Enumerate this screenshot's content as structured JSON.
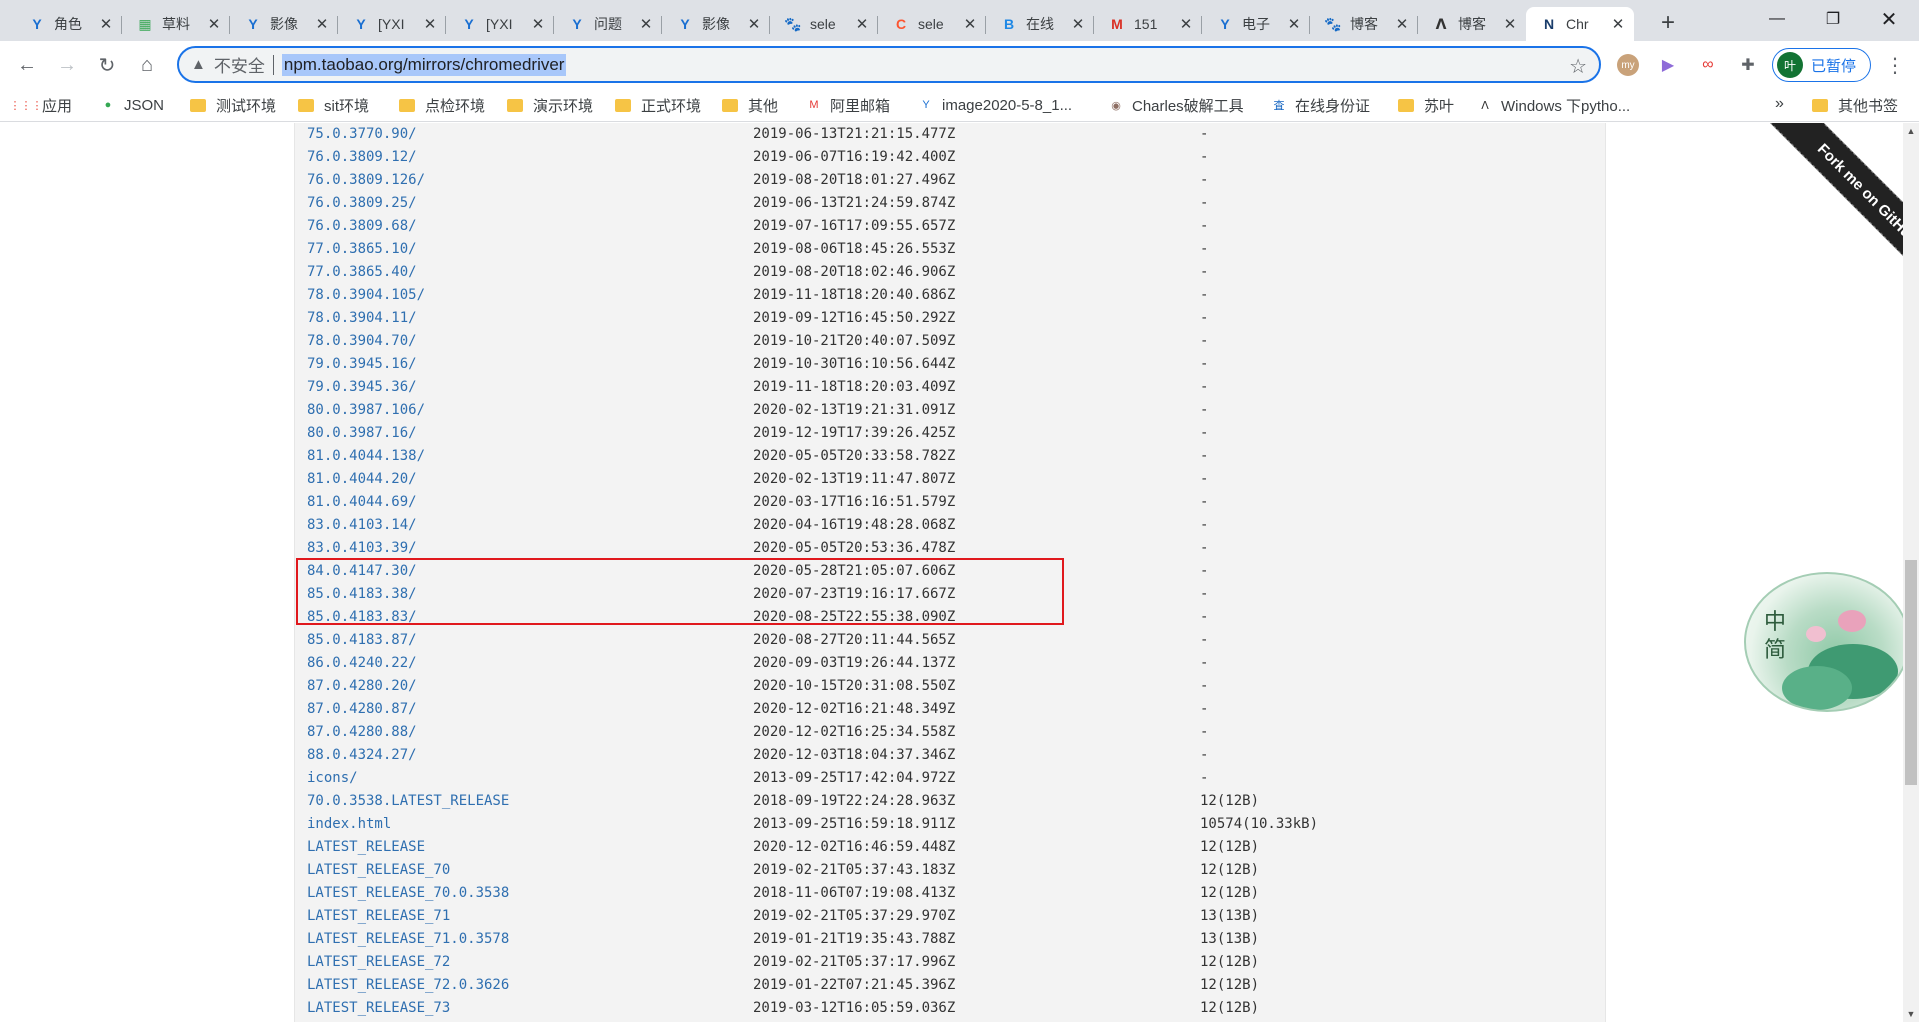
{
  "tabs": [
    {
      "title": "角色",
      "icon": "Y",
      "icon_name": "yonyou-icon",
      "color": "#1a6fd1"
    },
    {
      "title": "草料",
      "icon": "▦",
      "icon_name": "qr-grid-icon",
      "color": "#3aa757"
    },
    {
      "title": "影像",
      "icon": "Y",
      "icon_name": "yonyou-icon",
      "color": "#1a6fd1"
    },
    {
      "title": "[YXI",
      "icon": "Y",
      "icon_name": "yonyou-icon",
      "color": "#1a6fd1"
    },
    {
      "title": "[YXI",
      "icon": "Y",
      "icon_name": "yonyou-icon",
      "color": "#1a6fd1"
    },
    {
      "title": "问题",
      "icon": "Y",
      "icon_name": "yonyou-icon",
      "color": "#1a6fd1"
    },
    {
      "title": "影像",
      "icon": "Y",
      "icon_name": "yonyou-icon",
      "color": "#1a6fd1"
    },
    {
      "title": "sele",
      "icon": "🐾",
      "icon_name": "baidu-paw-icon",
      "color": "#2f5fdd"
    },
    {
      "title": "sele",
      "icon": "C",
      "icon_name": "csdn-icon",
      "color": "#fc5531"
    },
    {
      "title": "在线",
      "icon": "B",
      "icon_name": "b-logo-icon",
      "color": "#1e88e5"
    },
    {
      "title": "151",
      "icon": "M",
      "icon_name": "mail-m-icon",
      "color": "#d93025"
    },
    {
      "title": "电子",
      "icon": "Y",
      "icon_name": "yonyou-icon",
      "color": "#1a6fd1"
    },
    {
      "title": "博客",
      "icon": "🐾",
      "icon_name": "baidu-paw-icon",
      "color": "#2f5fdd"
    },
    {
      "title": "博客",
      "icon": "ᐱ",
      "icon_name": "blog-logo-icon",
      "color": "#333333"
    },
    {
      "title": "Chr",
      "icon": "N",
      "icon_name": "npm-n-icon",
      "color": "#1a3d6b",
      "active": true
    }
  ],
  "address": {
    "security_label": "不安全",
    "url": "npm.taobao.org/mirrors/chromedriver"
  },
  "profile": {
    "avatar_text": "叶",
    "label": "已暂停"
  },
  "bookmarks": [
    {
      "label": "应用",
      "type": "apps"
    },
    {
      "label": "JSON",
      "type": "json"
    },
    {
      "label": "测试环境",
      "type": "folder"
    },
    {
      "label": "sit环境",
      "type": "folder"
    },
    {
      "label": "点检环境",
      "type": "folder"
    },
    {
      "label": "演示环境",
      "type": "folder"
    },
    {
      "label": "正式环境",
      "type": "folder"
    },
    {
      "label": "其他",
      "type": "folder"
    },
    {
      "label": "阿里邮箱",
      "type": "mail"
    },
    {
      "label": "image2020-5-8_1...",
      "type": "yonyou"
    },
    {
      "label": "Charles破解工具",
      "type": "charles"
    },
    {
      "label": "在线身份证",
      "type": "cha"
    },
    {
      "label": "苏叶",
      "type": "folder"
    },
    {
      "label": "Windows 下pytho...",
      "type": "blog"
    }
  ],
  "bookmarks_overflow": "»",
  "other_bookmarks": "其他书签",
  "listing": [
    {
      "name": "75.0.3770.90/",
      "date": "2019-06-13T21:21:15.477Z",
      "size": "-"
    },
    {
      "name": "76.0.3809.12/",
      "date": "2019-06-07T16:19:42.400Z",
      "size": "-"
    },
    {
      "name": "76.0.3809.126/",
      "date": "2019-08-20T18:01:27.496Z",
      "size": "-"
    },
    {
      "name": "76.0.3809.25/",
      "date": "2019-06-13T21:24:59.874Z",
      "size": "-"
    },
    {
      "name": "76.0.3809.68/",
      "date": "2019-07-16T17:09:55.657Z",
      "size": "-"
    },
    {
      "name": "77.0.3865.10/",
      "date": "2019-08-06T18:45:26.553Z",
      "size": "-"
    },
    {
      "name": "77.0.3865.40/",
      "date": "2019-08-20T18:02:46.906Z",
      "size": "-"
    },
    {
      "name": "78.0.3904.105/",
      "date": "2019-11-18T18:20:40.686Z",
      "size": "-"
    },
    {
      "name": "78.0.3904.11/",
      "date": "2019-09-12T16:45:50.292Z",
      "size": "-"
    },
    {
      "name": "78.0.3904.70/",
      "date": "2019-10-21T20:40:07.509Z",
      "size": "-"
    },
    {
      "name": "79.0.3945.16/",
      "date": "2019-10-30T16:10:56.644Z",
      "size": "-"
    },
    {
      "name": "79.0.3945.36/",
      "date": "2019-11-18T18:20:03.409Z",
      "size": "-"
    },
    {
      "name": "80.0.3987.106/",
      "date": "2020-02-13T19:21:31.091Z",
      "size": "-"
    },
    {
      "name": "80.0.3987.16/",
      "date": "2019-12-19T17:39:26.425Z",
      "size": "-"
    },
    {
      "name": "81.0.4044.138/",
      "date": "2020-05-05T20:33:58.782Z",
      "size": "-"
    },
    {
      "name": "81.0.4044.20/",
      "date": "2020-02-13T19:11:47.807Z",
      "size": "-"
    },
    {
      "name": "81.0.4044.69/",
      "date": "2020-03-17T16:16:51.579Z",
      "size": "-"
    },
    {
      "name": "83.0.4103.14/",
      "date": "2020-04-16T19:48:28.068Z",
      "size": "-"
    },
    {
      "name": "83.0.4103.39/",
      "date": "2020-05-05T20:53:36.478Z",
      "size": "-"
    },
    {
      "name": "84.0.4147.30/",
      "date": "2020-05-28T21:05:07.606Z",
      "size": "-"
    },
    {
      "name": "85.0.4183.38/",
      "date": "2020-07-23T19:16:17.667Z",
      "size": "-"
    },
    {
      "name": "85.0.4183.83/",
      "date": "2020-08-25T22:55:38.090Z",
      "size": "-"
    },
    {
      "name": "85.0.4183.87/",
      "date": "2020-08-27T20:11:44.565Z",
      "size": "-"
    },
    {
      "name": "86.0.4240.22/",
      "date": "2020-09-03T19:26:44.137Z",
      "size": "-"
    },
    {
      "name": "87.0.4280.20/",
      "date": "2020-10-15T20:31:08.550Z",
      "size": "-"
    },
    {
      "name": "87.0.4280.87/",
      "date": "2020-12-02T16:21:48.349Z",
      "size": "-"
    },
    {
      "name": "87.0.4280.88/",
      "date": "2020-12-02T16:25:34.558Z",
      "size": "-"
    },
    {
      "name": "88.0.4324.27/",
      "date": "2020-12-03T18:04:37.346Z",
      "size": "-"
    },
    {
      "name": "icons/",
      "date": "2013-09-25T17:42:04.972Z",
      "size": "-"
    },
    {
      "name": "70.0.3538.LATEST_RELEASE",
      "date": "2018-09-19T22:24:28.963Z",
      "size": "12(12B)"
    },
    {
      "name": "index.html",
      "date": "2013-09-25T16:59:18.911Z",
      "size": "10574(10.33kB)"
    },
    {
      "name": "LATEST_RELEASE",
      "date": "2020-12-02T16:46:59.448Z",
      "size": "12(12B)"
    },
    {
      "name": "LATEST_RELEASE_70",
      "date": "2019-02-21T05:37:43.183Z",
      "size": "12(12B)"
    },
    {
      "name": "LATEST_RELEASE_70.0.3538",
      "date": "2018-11-06T07:19:08.413Z",
      "size": "12(12B)"
    },
    {
      "name": "LATEST_RELEASE_71",
      "date": "2019-02-21T05:37:29.970Z",
      "size": "13(13B)"
    },
    {
      "name": "LATEST_RELEASE_71.0.3578",
      "date": "2019-01-21T19:35:43.788Z",
      "size": "13(13B)"
    },
    {
      "name": "LATEST_RELEASE_72",
      "date": "2019-02-21T05:37:17.996Z",
      "size": "12(12B)"
    },
    {
      "name": "LATEST_RELEASE_72.0.3626",
      "date": "2019-01-22T07:21:45.396Z",
      "size": "12(12B)"
    },
    {
      "name": "LATEST_RELEASE_73",
      "date": "2019-03-12T16:05:59.036Z",
      "size": "12(12B)"
    }
  ],
  "fork_ribbon": "Fork me on GitHub",
  "widget": {
    "line1": "中",
    "line2": "简"
  },
  "colors": {
    "link": "#2f6fb0",
    "highlight": "#e0181d",
    "accent": "#1a73e8"
  }
}
